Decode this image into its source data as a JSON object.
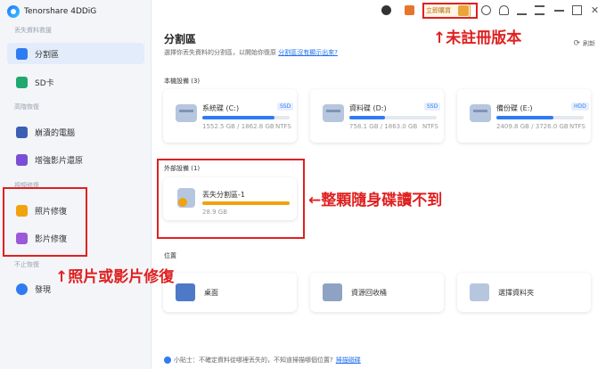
{
  "app": {
    "title": "Tenorshare 4DDiG"
  },
  "sidebar": {
    "sections": [
      {
        "title": "丟失資料救援"
      },
      {
        "title": "高階恢復"
      },
      {
        "title": "視頻修復"
      },
      {
        "title": "不止恢復"
      }
    ],
    "items": [
      {
        "label": "分割區",
        "icon": "partition-icon",
        "active": true
      },
      {
        "label": "SD卡",
        "icon": "sd-card-icon"
      },
      {
        "label": "崩潰的電腦",
        "icon": "crashed-pc-icon"
      },
      {
        "label": "增強影片還原",
        "icon": "enhanced-video-icon"
      },
      {
        "label": "照片修復",
        "icon": "photo-repair-icon"
      },
      {
        "label": "影片修復",
        "icon": "video-repair-icon"
      },
      {
        "label": "發現",
        "icon": "discover-icon"
      }
    ]
  },
  "topbar": {
    "buy_label": "立即購買",
    "icons": [
      "robot-icon",
      "gift-icon",
      "buy-icon",
      "tools-icon",
      "headset-icon",
      "download-icon",
      "menu-icon",
      "minimize-icon",
      "maximize-icon",
      "close-icon"
    ]
  },
  "main": {
    "title": "分割區",
    "description": "選擇你丟失資料的分割區，以開始你復原",
    "description_link": "分割區沒有顯示出來?",
    "refresh": "刷新",
    "local_title": "本機設備 (3)",
    "external_title": "外部設備 (1)",
    "location_title": "位置",
    "local_drives": [
      {
        "name": "系統碟 (C:)",
        "tag": "SSD",
        "size": "1552.5 GB / 1862.8 GB",
        "fs": "NTFS",
        "used_ratio": 0.83
      },
      {
        "name": "資料碟 (D:)",
        "tag": "SSD",
        "size": "758.1 GB / 1863.0 GB",
        "fs": "NTFS",
        "used_ratio": 0.41
      },
      {
        "name": "備份碟 (E:)",
        "tag": "HDD",
        "size": "2409.8 GB / 3726.0 GB",
        "fs": "NTFS",
        "used_ratio": 0.65
      }
    ],
    "external_drives": [
      {
        "name": "丟失分割區-1",
        "size": "28.9 GB",
        "used_ratio": 1.0
      }
    ],
    "locations": [
      {
        "label": "桌面",
        "icon": "desktop-icon"
      },
      {
        "label": "資源回收桶",
        "icon": "recycle-bin-icon"
      },
      {
        "label": "選擇資料夾",
        "icon": "folder-icon"
      }
    ],
    "tip": "小貼士：不確定資料從哪裡丟失的，不知道掃描哪個位置?",
    "tip_link": "掃描磁碟"
  },
  "annotations": {
    "unregistered": "↑未註冊版本",
    "drive_unreadable": "←整顆隨身碟讀不到",
    "photo_video_repair": "↑照片或影片修復"
  },
  "colors": {
    "accent": "#2f7cf2",
    "external_bar": "#f0a20f",
    "annotation": "#e02020"
  }
}
